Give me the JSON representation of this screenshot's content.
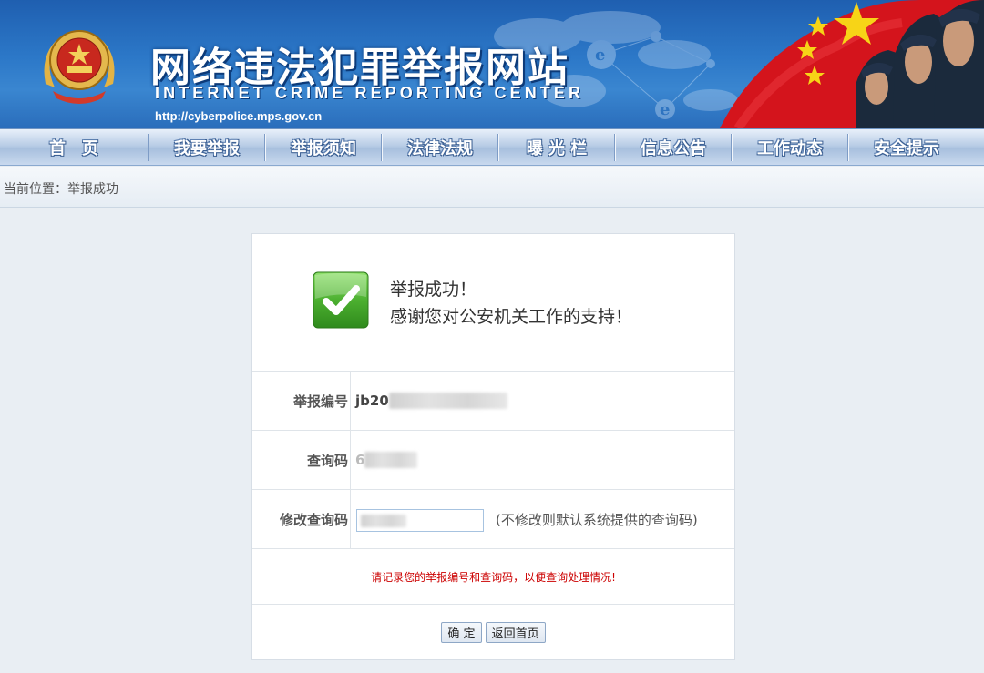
{
  "banner": {
    "title": "网络违法犯罪举报网站",
    "subtitle": "INTERNET CRIME REPORTING CENTER",
    "url": "http://cyberpolice.mps.gov.cn",
    "emblem_icon": "police-emblem-icon",
    "flag_icon": "china-flag-icon"
  },
  "nav": {
    "items": [
      "首　页",
      "我要举报",
      "举报须知",
      "法律法规",
      "曝 光 栏",
      "信息公告",
      "工作动态",
      "安全提示"
    ]
  },
  "breadcrumb": {
    "text": "当前位置：举报成功"
  },
  "result": {
    "title": "举报成功！",
    "message": "感谢您对公安机关工作的支持！",
    "icon": "success-check-icon",
    "report_id_label": "举报编号",
    "report_id_prefix": "jb20",
    "query_code_label": "查询码",
    "query_code_prefix": "6",
    "edit_code_label": "修改查询码",
    "edit_code_note": "(不修改则默认系统提供的查询码)",
    "notice": "请记录您的举报编号和查询码，以便查询处理情况!",
    "confirm_label": "确 定",
    "home_label": "返回首页"
  },
  "colors": {
    "banner_blue": "#2c78c8",
    "notice_red": "#cc0000",
    "success_green": "#4cb030"
  }
}
